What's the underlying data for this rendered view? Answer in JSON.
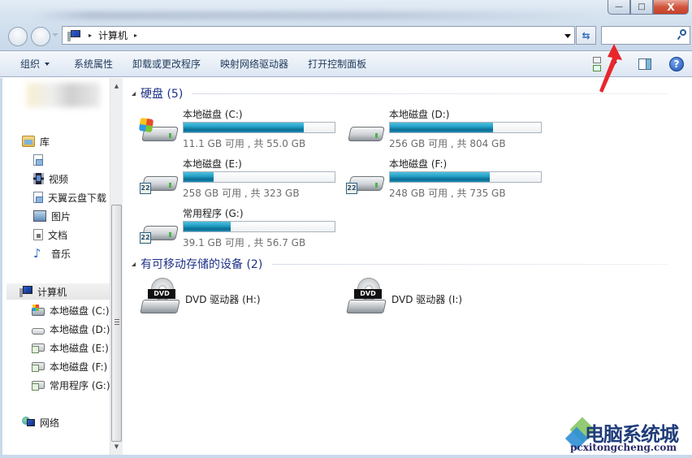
{
  "window": {
    "title_blurred": true,
    "controls": {
      "minimize": "—",
      "maximize": "□",
      "close": "X"
    }
  },
  "address_bar": {
    "segments": [
      "计算机"
    ],
    "separator": "▸"
  },
  "search": {
    "placeholder": "",
    "value": ""
  },
  "toolbar": {
    "items": [
      {
        "label": "组织",
        "has_dropdown": true
      },
      {
        "label": "系统属性"
      },
      {
        "label": "卸载或更改程序"
      },
      {
        "label": "映射网络驱动器"
      },
      {
        "label": "打开控制面板"
      }
    ],
    "right_icons": [
      "change-view-icon",
      "preview-pane-icon",
      "help-icon"
    ],
    "help_label": "?"
  },
  "sidebar": {
    "user_blurred": true,
    "libraries": {
      "label": "库",
      "items": [
        {
          "label": "",
          "icon": "library-doc-icon"
        },
        {
          "label": "视频",
          "icon": "video-icon"
        },
        {
          "label": "天翼云盘下载",
          "icon": "library-doc-icon"
        },
        {
          "label": "图片",
          "icon": "picture-icon"
        },
        {
          "label": "文档",
          "icon": "document-icon"
        },
        {
          "label": "音乐",
          "icon": "music-icon"
        }
      ]
    },
    "computer": {
      "label": "计算机",
      "selected": true,
      "items": [
        {
          "label": "本地磁盘 (C:)",
          "icon": "windows-drive-icon"
        },
        {
          "label": "本地磁盘 (D:)",
          "icon": "drive-icon"
        },
        {
          "label": "本地磁盘 (E:)",
          "icon": "shared-drive-icon"
        },
        {
          "label": "本地磁盘 (F:)",
          "icon": "shared-drive-icon"
        },
        {
          "label": "常用程序 (G:)",
          "icon": "shared-drive-icon"
        }
      ]
    },
    "network": {
      "label": "网络"
    }
  },
  "main": {
    "hard_disks": {
      "title": "硬盘 (5)",
      "drives": [
        {
          "name": "本地磁盘 (C:)",
          "info": "11.1 GB 可用 , 共 55.0 GB",
          "free_gb": 11.1,
          "total_gb": 55.0,
          "used_fraction": 0.798,
          "type": "system"
        },
        {
          "name": "本地磁盘 (D:)",
          "info": "256 GB 可用 , 共 804 GB",
          "free_gb": 256,
          "total_gb": 804,
          "used_fraction": 0.682,
          "type": "plain"
        },
        {
          "name": "本地磁盘 (E:)",
          "info": "258 GB 可用 , 共 323 GB",
          "free_gb": 258,
          "total_gb": 323,
          "used_fraction": 0.201,
          "type": "shared"
        },
        {
          "name": "本地磁盘 (F:)",
          "info": "248 GB 可用 , 共 735 GB",
          "free_gb": 248,
          "total_gb": 735,
          "used_fraction": 0.663,
          "type": "shared"
        },
        {
          "name": "常用程序 (G:)",
          "info": "39.1 GB 可用 , 共 56.7 GB",
          "free_gb": 39.1,
          "total_gb": 56.7,
          "used_fraction": 0.31,
          "type": "shared"
        }
      ]
    },
    "removable": {
      "title": "有可移动存储的设备 (2)",
      "devices": [
        {
          "name": "DVD 驱动器 (H:)",
          "badge": "DVD"
        },
        {
          "name": "DVD 驱动器 (I:)",
          "badge": "DVD"
        }
      ]
    }
  },
  "watermark": {
    "title": "电脑系统城",
    "subtitle": "pcxitongcheng.com"
  },
  "colors": {
    "group_title": "#1e3287",
    "bar_fill": "#26a2c8",
    "annotation_arrow": "#e8262b"
  }
}
